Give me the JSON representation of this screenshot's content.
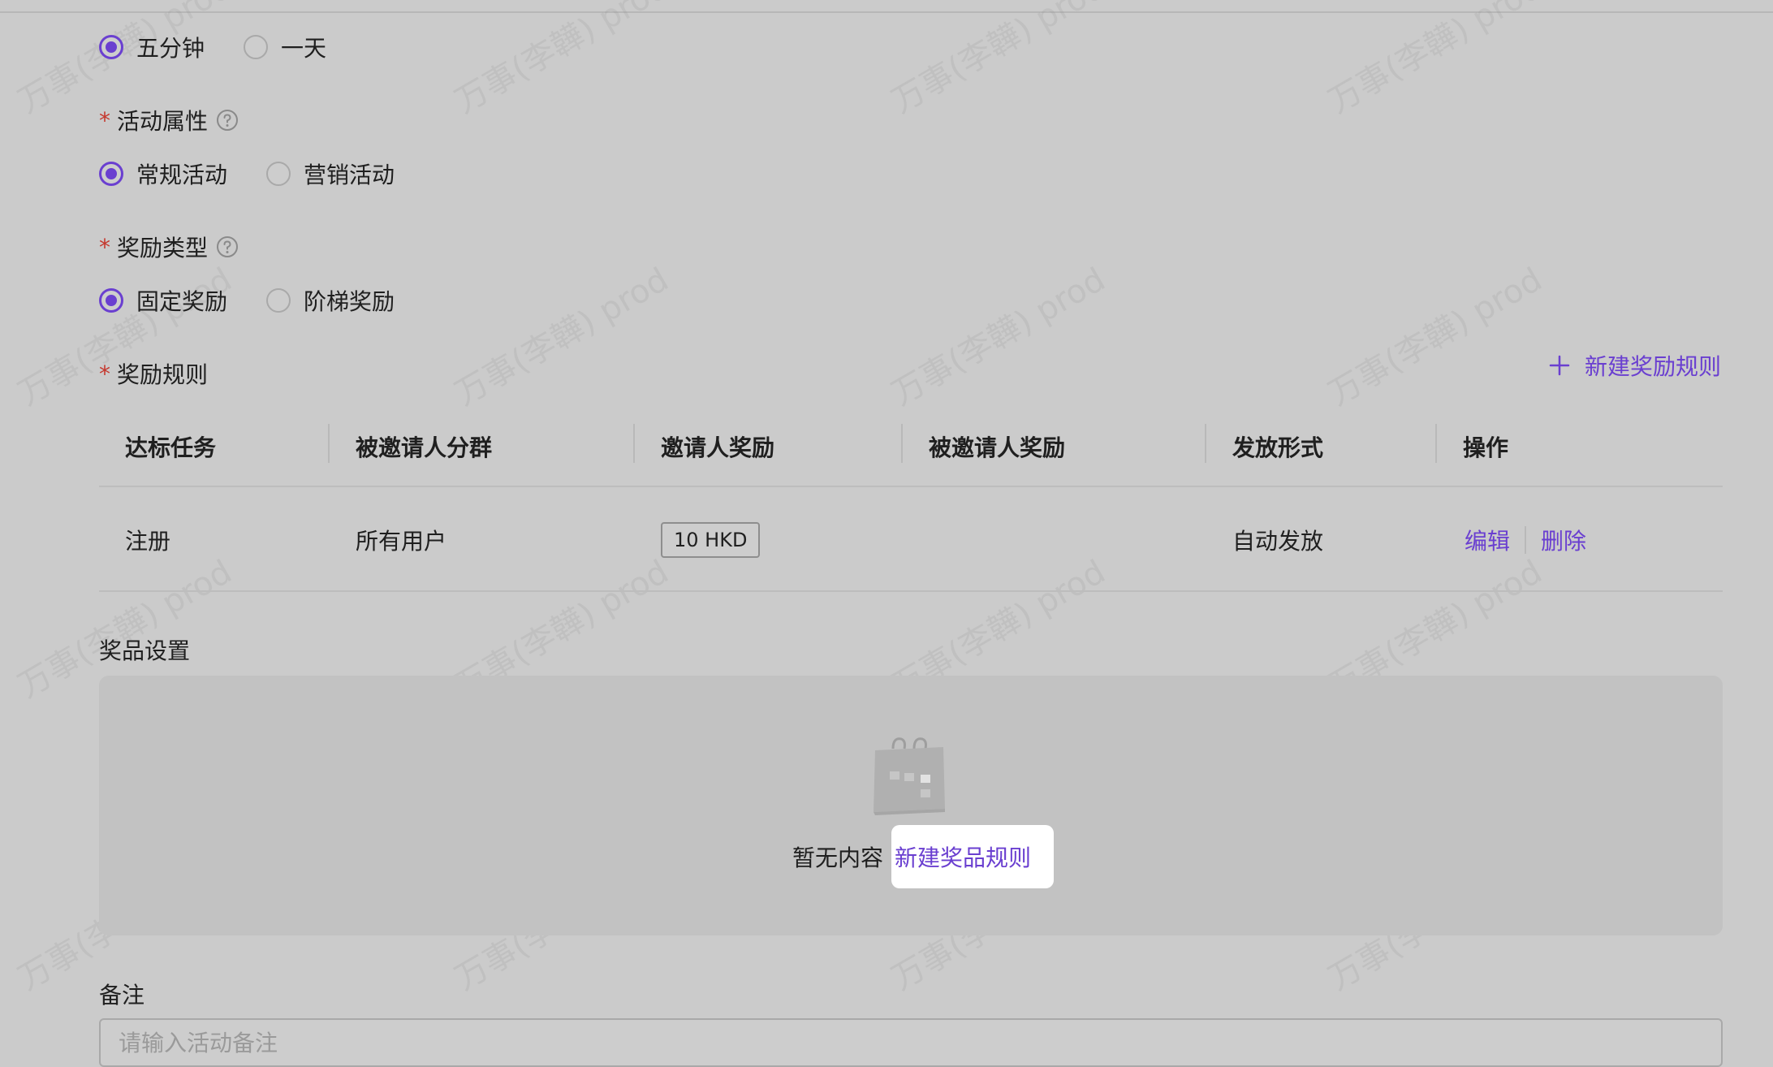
{
  "watermark": "万事(李韡) prod",
  "duration": {
    "options": [
      "五分钟",
      "一天"
    ],
    "selected": 0
  },
  "activity_attribute": {
    "label": "活动属性",
    "options": [
      "常规活动",
      "营销活动"
    ],
    "selected": 0
  },
  "reward_type": {
    "label": "奖励类型",
    "options": [
      "固定奖励",
      "阶梯奖励"
    ],
    "selected": 0
  },
  "reward_rules": {
    "label": "奖励规则",
    "add_label": "新建奖励规则",
    "columns": [
      "达标任务",
      "被邀请人分群",
      "邀请人奖励",
      "被邀请人奖励",
      "发放形式",
      "操作"
    ],
    "rows": [
      {
        "task": "注册",
        "segment": "所有用户",
        "inviter_reward": "10 HKD",
        "invitee_reward": "",
        "distribution": "自动发放",
        "edit_label": "编辑",
        "delete_label": "删除"
      }
    ]
  },
  "prize_settings": {
    "title": "奖品设置",
    "empty_text": "暂无内容",
    "create_label": "新建奖品规则"
  },
  "remark": {
    "title": "备注",
    "placeholder": "请输入活动备注"
  },
  "colors": {
    "accent": "#6a3fd0",
    "required": "#c5382e",
    "background": "#cbcbcb"
  }
}
